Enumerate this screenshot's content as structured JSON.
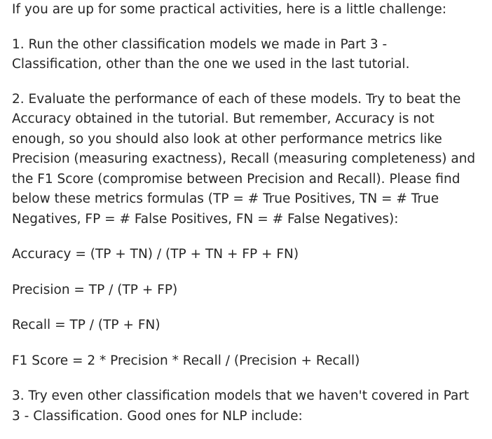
{
  "intro": "If you are up for some practical activities, here is a little challenge:",
  "item1": {
    "lines": [
      "1. Run the other classification models we made in Part 3 -",
      "Classification, other than the one we used in the last tutorial."
    ]
  },
  "item2": {
    "lines": [
      "2. Evaluate the performance of each of these models. Try to beat the",
      "Accuracy obtained in the tutorial. But remember, Accuracy is not",
      "enough, so you should also look at other performance metrics like",
      "Precision (measuring exactness), Recall (measuring completeness) and",
      "the F1 Score (compromise between Precision and Recall). Please find",
      "below these metrics formulas (TP = # True Positives, TN = # True",
      "Negatives, FP = # False Positives, FN = # False Negatives):"
    ]
  },
  "formulas": {
    "accuracy": "Accuracy = (TP + TN) / (TP + TN + FP + FN)",
    "precision": "Precision = TP / (TP + FP)",
    "recall": "Recall = TP / (TP + FN)",
    "f1": "F1 Score = 2 * Precision * Recall / (Precision + Recall)"
  },
  "item3": {
    "lines": [
      "3. Try even other classification models that we haven't covered in Part",
      "3 - Classification. Good ones for NLP include:"
    ]
  }
}
